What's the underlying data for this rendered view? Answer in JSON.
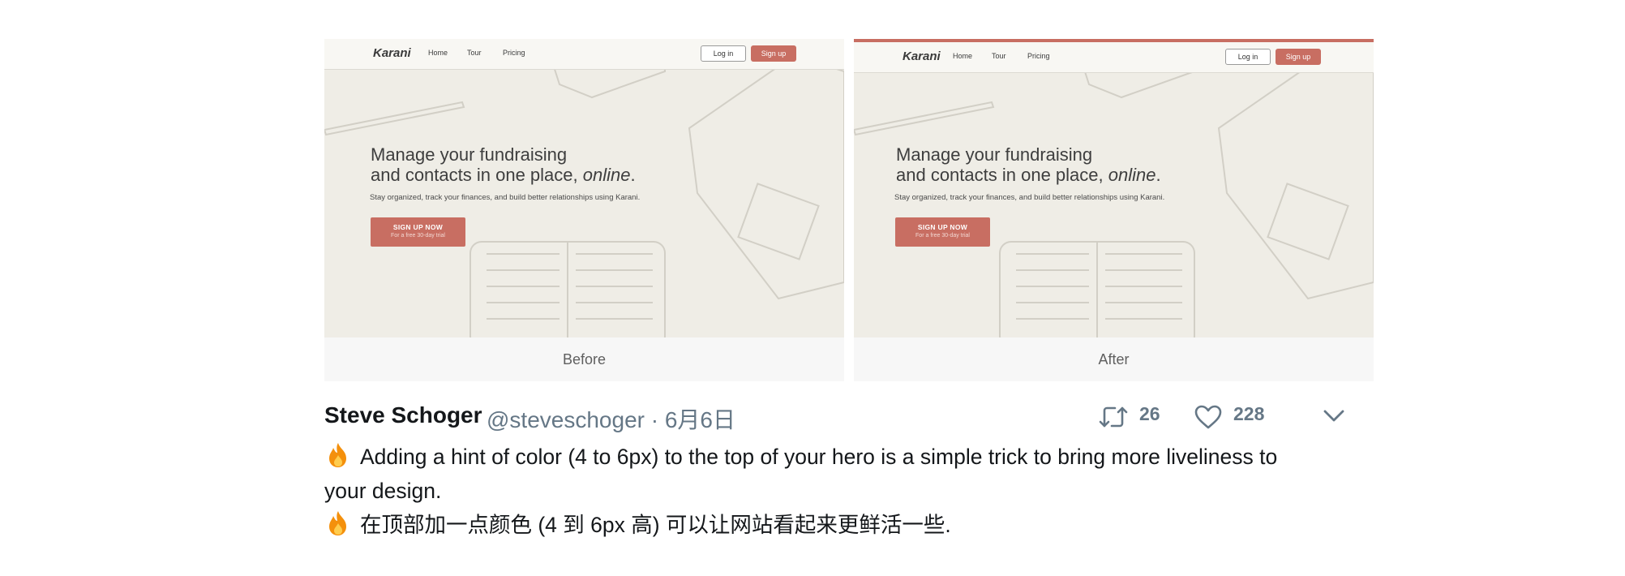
{
  "panels": [
    {
      "caption": "Before",
      "site": {
        "logo": "Karani",
        "nav": [
          "Home",
          "Tour",
          "Pricing"
        ],
        "login": "Log in",
        "signup": "Sign up",
        "hero_line1": "Manage your fundraising",
        "hero_line2_prefix": "and contacts in one place, ",
        "hero_line2_em": "online",
        "hero_line2_suffix": ".",
        "subtitle": "Stay organized, track your finances, and build better relationships using Karani.",
        "cta_main": "SIGN UP NOW",
        "cta_sub": "For a free 30-day trial"
      }
    },
    {
      "caption": "After",
      "accent_color": "#c86e62",
      "site": {
        "logo": "Karani",
        "nav": [
          "Home",
          "Tour",
          "Pricing"
        ],
        "login": "Log in",
        "signup": "Sign up",
        "hero_line1": "Manage your fundraising",
        "hero_line2_prefix": "and contacts in one place, ",
        "hero_line2_em": "online",
        "hero_line2_suffix": ".",
        "subtitle": "Stay organized, track your finances, and build better relationships using Karani.",
        "cta_main": "SIGN UP NOW",
        "cta_sub": "For a free 30-day trial"
      }
    }
  ],
  "tweet": {
    "author": "Steve Schoger",
    "handle_date": "@steveschoger · 6月6日",
    "retweets": "26",
    "likes": "228",
    "line1": "Adding a hint of color (4 to 6px) to the top of your hero is a simple trick to bring more liveliness to",
    "line2": "your design.",
    "line3": "在顶部加一点颜色 (4 到 6px 高) 可以让网站看起来更鲜活一些.",
    "emoji_icon": "fire-icon"
  },
  "colors": {
    "accent": "#c86e62",
    "text_secondary": "#657786"
  }
}
